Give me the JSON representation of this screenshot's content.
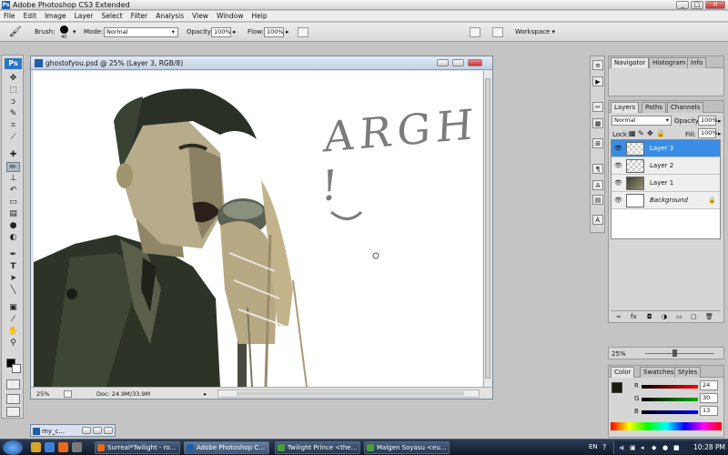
{
  "app": {
    "title": "Adobe Photoshop CS3 Extended",
    "logo": "Ps"
  },
  "menu": [
    "File",
    "Edit",
    "Image",
    "Layer",
    "Select",
    "Filter",
    "Analysis",
    "View",
    "Window",
    "Help"
  ],
  "options_bar": {
    "brush_label": "Brush:",
    "brush_size": "40",
    "mode_label": "Mode:",
    "mode_value": "Normal",
    "opacity_label": "Opacity:",
    "opacity_value": "100%",
    "flow_label": "Flow:",
    "flow_value": "100%",
    "workspace_label": "Workspace"
  },
  "tools": [
    "move",
    "marquee",
    "lasso",
    "quick-select",
    "crop",
    "slice",
    "healing",
    "brush",
    "clone-stamp",
    "history-brush",
    "eraser",
    "gradient",
    "blur",
    "dodge",
    "pen",
    "type",
    "path-select",
    "shape",
    "notes",
    "eyedropper",
    "hand",
    "zoom"
  ],
  "document": {
    "title": "ghostofyou.psd @ 25% (Layer 3, RGB/8)",
    "zoom": "25%",
    "doc_info": "Doc: 24.9M/33.9M",
    "canvas_text": "ARGH !"
  },
  "navigator_panel": {
    "tabs": [
      "Navigator",
      "Histogram",
      "Info"
    ],
    "zoom": "25%"
  },
  "layers_panel": {
    "tabs": [
      "Layers",
      "Paths",
      "Channels"
    ],
    "blend_mode": "Normal",
    "opacity_label": "Opacity:",
    "opacity_value": "100%",
    "lock_label": "Lock:",
    "fill_label": "Fill:",
    "fill_value": "100%",
    "layers": [
      {
        "name": "Layer 3",
        "selected": true,
        "thumb": "transparent"
      },
      {
        "name": "Layer 2",
        "selected": false,
        "thumb": "transparent"
      },
      {
        "name": "Layer 1",
        "selected": false,
        "thumb": "photo"
      },
      {
        "name": "Background",
        "selected": false,
        "thumb": "solid",
        "locked": true
      }
    ]
  },
  "color_panel": {
    "tabs": [
      "Color",
      "Swatches",
      "Styles"
    ],
    "channels": [
      {
        "label": "R",
        "value": "24"
      },
      {
        "label": "G",
        "value": "30"
      },
      {
        "label": "B",
        "value": "13"
      }
    ],
    "foreground": "#181e0d"
  },
  "minimized_doc": {
    "label": "my_c..."
  },
  "taskbar": {
    "tasks": [
      {
        "label": "Surreal*Twilight - ro...",
        "active": false
      },
      {
        "label": "Adobe Photoshop C...",
        "active": true
      },
      {
        "label": "Twilight Prince <the...",
        "active": false
      },
      {
        "label": "Malgen Soyasu <eu...",
        "active": false
      }
    ],
    "language": "EN",
    "time": "10:28 PM"
  }
}
